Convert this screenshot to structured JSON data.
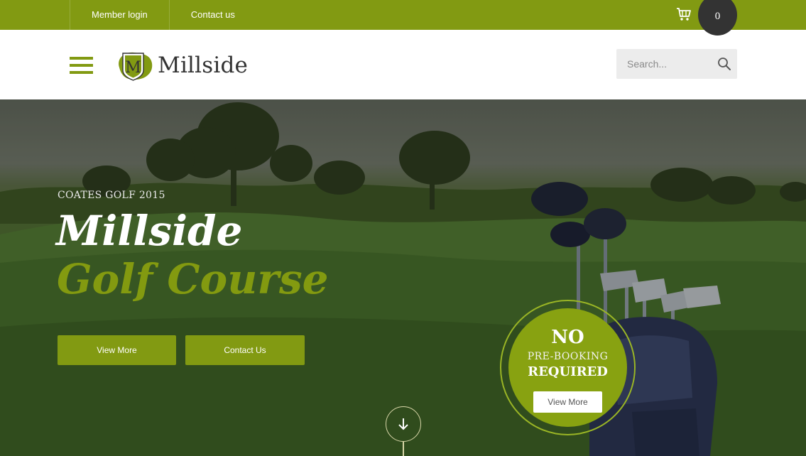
{
  "topbar": {
    "links": [
      "Member login",
      "Contact us"
    ],
    "cart_icon": "shopping-cart-icon",
    "cart_count": "0"
  },
  "header": {
    "menu_icon": "hamburger-menu-icon",
    "logo_letter": "M",
    "logo_text": "Millside",
    "search_placeholder": "Search...",
    "search_icon": "magnifier-icon"
  },
  "hero": {
    "kicker": "COATES GOLF 2015",
    "title_line1": "Millside",
    "title_line2": "Golf Course",
    "buttons": [
      "View More",
      "Contact Us"
    ],
    "scroll_icon": "arrow-down-icon"
  },
  "badge": {
    "line1": "NO",
    "line2": "PRE-BOOKING",
    "line3": "REQUIRED",
    "button": "View More"
  },
  "colors": {
    "brand_green": "#829a12",
    "dark": "#333333",
    "white": "#ffffff"
  }
}
